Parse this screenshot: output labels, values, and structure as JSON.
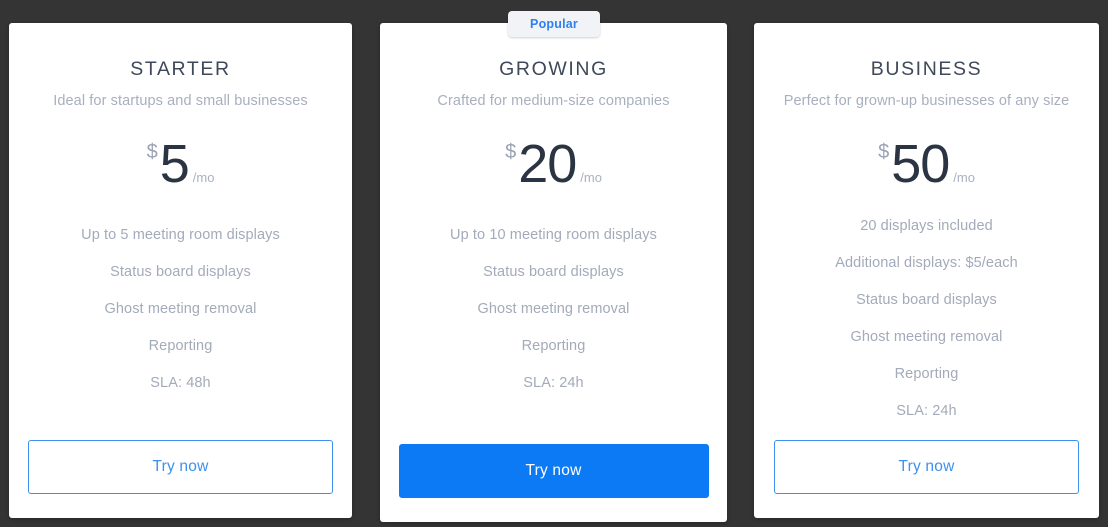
{
  "badge": {
    "label": "Popular",
    "color": "#2f80f0",
    "background": "#f1f3f6"
  },
  "theme": {
    "page_background": "#343434",
    "card_background": "#ffffff",
    "accent_blue": "#0d7af5",
    "outline_blue": "#3d90f0",
    "title_color": "#3f4959",
    "muted_text": "#a8afbf",
    "price_color": "#2b3442"
  },
  "plans": [
    {
      "id": "starter",
      "title": "STARTER",
      "subtitle": "Ideal for startups and small businesses",
      "currency": "$",
      "amount": "5",
      "period": "/mo",
      "features": [
        "Up to 5 meeting room displays",
        "Status board displays",
        "Ghost meeting removal",
        "Reporting",
        "SLA: 48h"
      ],
      "cta_label": "Try now",
      "cta_style": "outline",
      "highlighted": false
    },
    {
      "id": "growing",
      "title": "GROWING",
      "subtitle": "Crafted for medium-size companies",
      "currency": "$",
      "amount": "20",
      "period": "/mo",
      "features": [
        "Up to 10 meeting room displays",
        "Status board displays",
        "Ghost meeting removal",
        "Reporting",
        "SLA: 24h"
      ],
      "cta_label": "Try now",
      "cta_style": "filled",
      "highlighted": true
    },
    {
      "id": "business",
      "title": "BUSINESS",
      "subtitle": "Perfect for grown-up businesses of any size",
      "currency": "$",
      "amount": "50",
      "period": "/mo",
      "features": [
        "20 displays included",
        "Additional displays: $5/each",
        "Status board displays",
        "Ghost meeting removal",
        "Reporting",
        "SLA: 24h"
      ],
      "cta_label": "Try now",
      "cta_style": "outline",
      "highlighted": false
    }
  ]
}
